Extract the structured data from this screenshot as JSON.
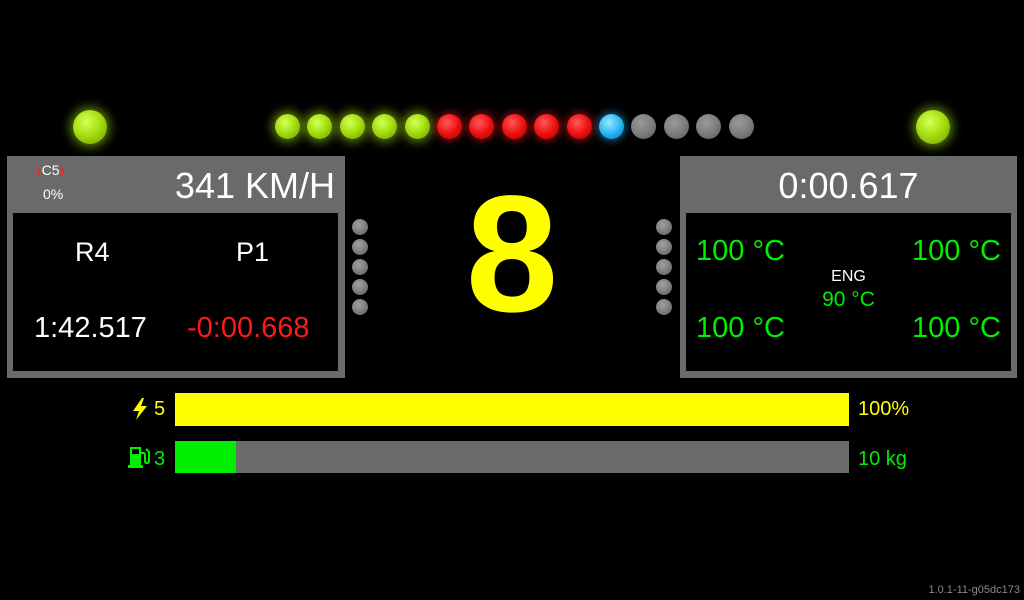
{
  "shift_lights": {
    "left_indicator": "green",
    "right_indicator": "green",
    "rpm_leds": [
      "green",
      "green",
      "green",
      "green",
      "green",
      "red",
      "red",
      "red",
      "red",
      "red",
      "blue",
      "off",
      "off",
      "off",
      "off"
    ]
  },
  "left_panel": {
    "compound": "C5",
    "compound_wear": "0%",
    "speed": "341 KM/H",
    "round": "R4",
    "position": "P1",
    "lap_time": "1:42.517",
    "delta": "-0:00.668"
  },
  "gear": "8",
  "right_panel": {
    "timer": "0:00.617",
    "tyre_temp_fl": "100 °C",
    "tyre_temp_fr": "100 °C",
    "tyre_temp_rl": "100 °C",
    "tyre_temp_rr": "100 °C",
    "engine_label": "ENG",
    "engine_temp": "90 °C"
  },
  "ers": {
    "mode": "5",
    "level_text": "100%",
    "level_fraction": 1.0,
    "color": "#ffff00"
  },
  "fuel": {
    "mix": "3",
    "amount_text": "10 kg",
    "level_fraction": 0.09,
    "color": "#00ee00"
  },
  "version": "1.0.1-11-g05dc173",
  "colors": {
    "accent_green": "#00ee00",
    "accent_yellow": "#ffff00",
    "delta_red": "#ff1a1a",
    "compound_red": "#ff1a1a",
    "panel_gray": "#6a6a6a"
  }
}
